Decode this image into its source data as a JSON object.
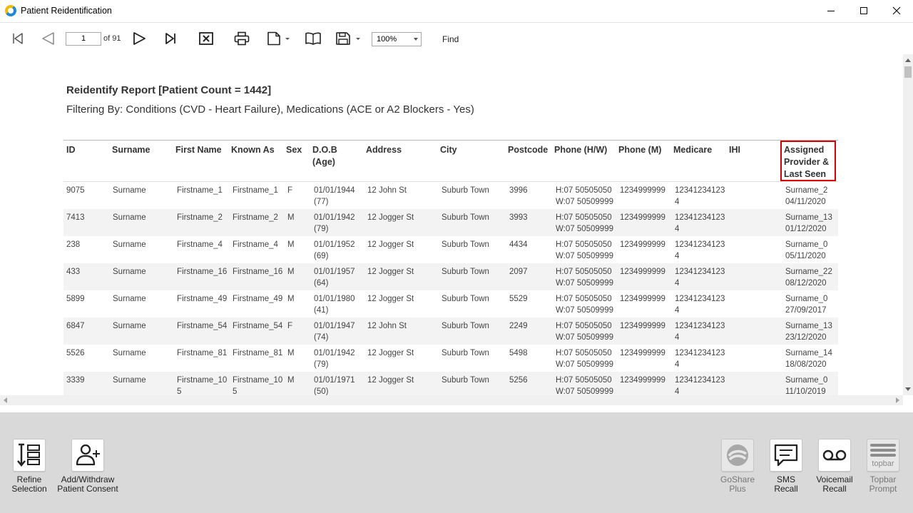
{
  "window": {
    "title": "Patient Reidentification"
  },
  "toolbar": {
    "page_value": "1",
    "page_of": "of 91",
    "zoom": "100%",
    "find_label": "Find"
  },
  "report": {
    "title": "Reidentify Report  [Patient Count = 1442]",
    "filter": "Filtering By: Conditions (CVD - Heart Failure), Medications (ACE or A2 Blockers - Yes)",
    "headers": {
      "id": "ID",
      "surname": "Surname",
      "first_name": "First Name",
      "known_as": "Known As",
      "sex": "Sex",
      "dob_1": "D.O.B",
      "dob_2": "(Age)",
      "address": "Address",
      "city": "City",
      "postcode": "Postcode",
      "phone_hw": "Phone (H/W)",
      "phone_m": "Phone (M)",
      "medicare": "Medicare",
      "ihi": "IHI",
      "provider_1": "Assigned",
      "provider_2": "Provider &",
      "provider_3": "Last Seen"
    },
    "rows": [
      {
        "id": "9075",
        "surname": "Surname",
        "first_1": "Firstname_1",
        "first_2": "",
        "known_1": "Firstname_1",
        "known_2": "",
        "sex": "F",
        "dob": "01/01/1944",
        "age": "(77)",
        "address": "12 John St",
        "city": "Suburb Town",
        "postcode": "3996",
        "phone_h": "H:07 50505050",
        "phone_w": "W:07 50509999",
        "phone_m": "1234999999",
        "medicare_1": "12341234123",
        "medicare_2": "4",
        "provider": "Surname_2",
        "last_seen": "04/11/2020"
      },
      {
        "id": "7413",
        "surname": "Surname",
        "first_1": "Firstname_2",
        "first_2": "",
        "known_1": "Firstname_2",
        "known_2": "",
        "sex": "M",
        "dob": "01/01/1942",
        "age": "(79)",
        "address": "12 Jogger St",
        "city": "Suburb Town",
        "postcode": "3993",
        "phone_h": "H:07 50505050",
        "phone_w": "W:07 50509999",
        "phone_m": "1234999999",
        "medicare_1": "12341234123",
        "medicare_2": "4",
        "provider": "Surname_13",
        "last_seen": "01/12/2020"
      },
      {
        "id": "238",
        "surname": "Surname",
        "first_1": "Firstname_4",
        "first_2": "",
        "known_1": "Firstname_4",
        "known_2": "",
        "sex": "M",
        "dob": "01/01/1952",
        "age": "(69)",
        "address": "12 Jogger St",
        "city": "Suburb Town",
        "postcode": "4434",
        "phone_h": "H:07 50505050",
        "phone_w": "W:07 50509999",
        "phone_m": "1234999999",
        "medicare_1": "12341234123",
        "medicare_2": "4",
        "provider": "Surname_0",
        "last_seen": "05/11/2020"
      },
      {
        "id": "433",
        "surname": "Surname",
        "first_1": "Firstname_16",
        "first_2": "",
        "known_1": "Firstname_16",
        "known_2": "",
        "sex": "M",
        "dob": "01/01/1957",
        "age": "(64)",
        "address": "12 Jogger St",
        "city": "Suburb Town",
        "postcode": "2097",
        "phone_h": "H:07 50505050",
        "phone_w": "W:07 50509999",
        "phone_m": "1234999999",
        "medicare_1": "12341234123",
        "medicare_2": "4",
        "provider": "Surname_22",
        "last_seen": "08/12/2020"
      },
      {
        "id": "5899",
        "surname": "Surname",
        "first_1": "Firstname_49",
        "first_2": "",
        "known_1": "Firstname_49",
        "known_2": "",
        "sex": "M",
        "dob": "01/01/1980",
        "age": "(41)",
        "address": "12 Jogger St",
        "city": "Suburb Town",
        "postcode": "5529",
        "phone_h": "H:07 50505050",
        "phone_w": "W:07 50509999",
        "phone_m": "1234999999",
        "medicare_1": "12341234123",
        "medicare_2": "4",
        "provider": "Surname_0",
        "last_seen": "27/09/2017"
      },
      {
        "id": "6847",
        "surname": "Surname",
        "first_1": "Firstname_54",
        "first_2": "",
        "known_1": "Firstname_54",
        "known_2": "",
        "sex": "F",
        "dob": "01/01/1947",
        "age": "(74)",
        "address": "12 John St",
        "city": "Suburb Town",
        "postcode": "2249",
        "phone_h": "H:07 50505050",
        "phone_w": "W:07 50509999",
        "phone_m": "1234999999",
        "medicare_1": "12341234123",
        "medicare_2": "4",
        "provider": "Surname_13",
        "last_seen": "23/12/2020"
      },
      {
        "id": "5526",
        "surname": "Surname",
        "first_1": "Firstname_81",
        "first_2": "",
        "known_1": "Firstname_81",
        "known_2": "",
        "sex": "M",
        "dob": "01/01/1942",
        "age": "(79)",
        "address": "12 Jogger St",
        "city": "Suburb Town",
        "postcode": "5498",
        "phone_h": "H:07 50505050",
        "phone_w": "W:07 50509999",
        "phone_m": "1234999999",
        "medicare_1": "12341234123",
        "medicare_2": "4",
        "provider": "Surname_14",
        "last_seen": "18/08/2020"
      },
      {
        "id": "3339",
        "surname": "Surname",
        "first_1": "Firstname_10",
        "first_2": "5",
        "known_1": "Firstname_10",
        "known_2": "5",
        "sex": "M",
        "dob": "01/01/1971",
        "age": "(50)",
        "address": "12 Jogger St",
        "city": "Suburb Town",
        "postcode": "5256",
        "phone_h": "H:07 50505050",
        "phone_w": "W:07 50509999",
        "phone_m": "1234999999",
        "medicare_1": "12341234123",
        "medicare_2": "4",
        "provider": "Surname_0",
        "last_seen": "11/10/2019"
      }
    ]
  },
  "bottom_bar": {
    "refine_1": "Refine",
    "refine_2": "Selection",
    "consent_1": "Add/Withdraw",
    "consent_2": "Patient Consent",
    "goshare_1": "GoShare",
    "goshare_2": "Plus",
    "sms_1": "SMS",
    "sms_2": "Recall",
    "voicemail_1": "Voicemail",
    "voicemail_2": "Recall",
    "topbar_1": "Topbar",
    "topbar_2": "Prompt",
    "topbar_logo": "topbar"
  }
}
